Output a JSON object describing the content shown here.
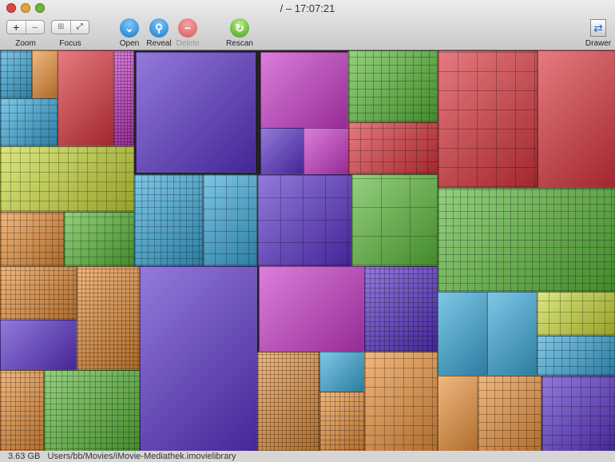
{
  "window": {
    "title": "/ – 17:07:21"
  },
  "toolbar": {
    "zoom_label": "Zoom",
    "zoom_in": "+",
    "zoom_out": "−",
    "focus_label": "Focus",
    "open_label": "Open",
    "reveal_label": "Reveal",
    "delete_label": "Delete",
    "rescan_label": "Rescan",
    "drawer_label": "Drawer"
  },
  "status": {
    "size": "3.63 GB",
    "path": "Users/bb/Movies/iMovie-Mediathek.imovielibrary"
  },
  "colors": {
    "purple": "#5a32c8",
    "red": "#d8343c",
    "green": "#5ab83a",
    "orange": "#e8903a",
    "yellow": "#c8d83a",
    "cyan": "#3aa8d8",
    "magenta": "#c83ac8"
  }
}
